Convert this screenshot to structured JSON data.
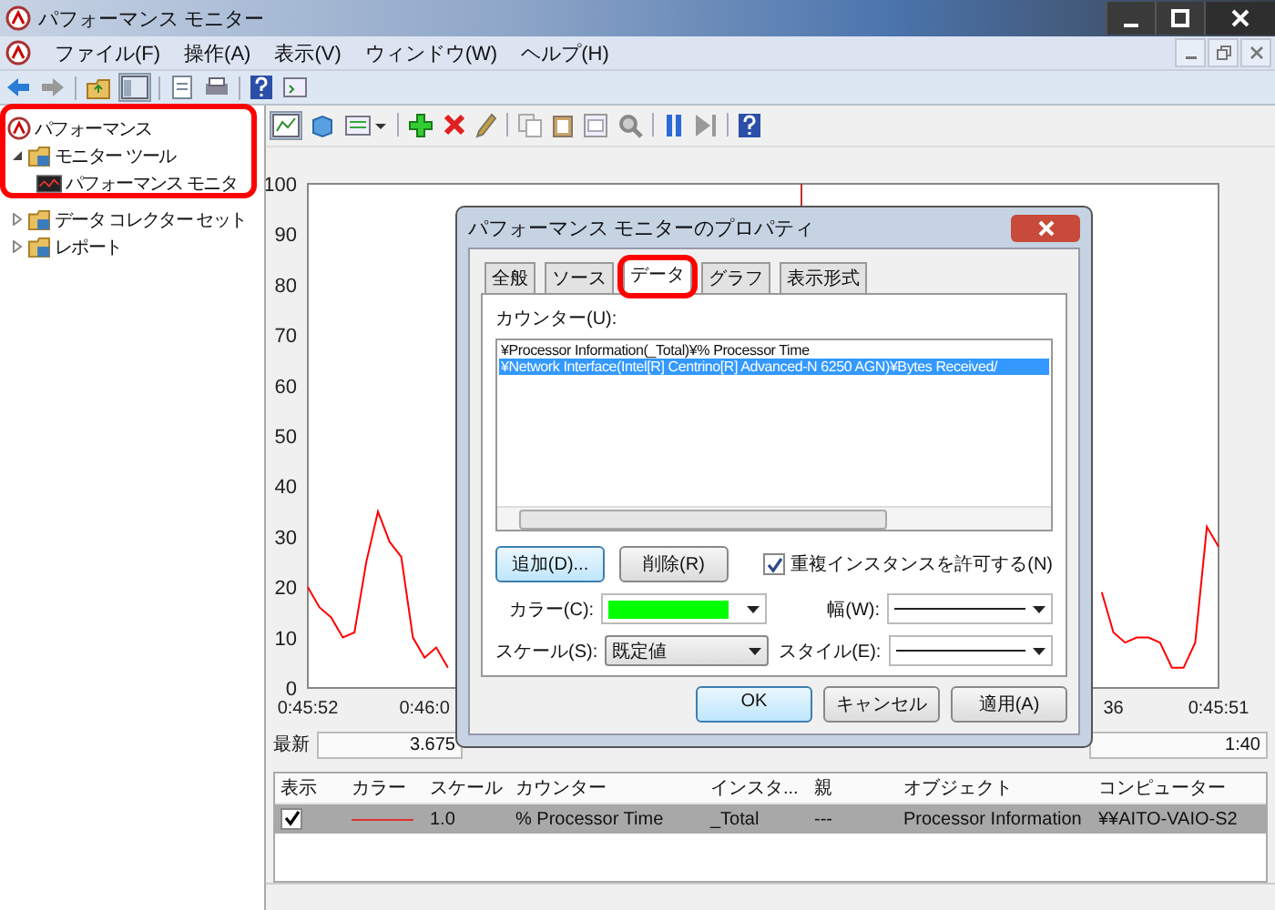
{
  "window": {
    "title": "パフォーマンス モニター"
  },
  "menu": [
    "ファイル(F)",
    "操作(A)",
    "表示(V)",
    "ウィンドウ(W)",
    "ヘルプ(H)"
  ],
  "tree": [
    {
      "label": "パフォーマンス",
      "children": [
        {
          "label": "モニター ツール",
          "expanded": true,
          "children": [
            {
              "label": "パフォーマンス モニタ"
            }
          ]
        },
        {
          "label": "データ コレクター セット",
          "expanded": false
        },
        {
          "label": "レポート",
          "expanded": false
        }
      ]
    }
  ],
  "graph": {
    "chart_data": {
      "type": "line",
      "ylim": [
        0,
        100
      ],
      "yticks": [
        0,
        10,
        20,
        30,
        40,
        50,
        60,
        70,
        80,
        90,
        100
      ],
      "categories": [
        "0:45:52",
        null,
        null,
        null,
        null,
        null,
        null,
        null,
        null,
        null,
        "0:46:0",
        null,
        null,
        null,
        null,
        null,
        null,
        null,
        null,
        null,
        null,
        null,
        null,
        null,
        null,
        null,
        null,
        null,
        null,
        null,
        null,
        null,
        null,
        null,
        null,
        null,
        null,
        null,
        null,
        null,
        null,
        null,
        null,
        null,
        null,
        null,
        null,
        null,
        null,
        null,
        null,
        null,
        null,
        null,
        null,
        null,
        null,
        null,
        null,
        null,
        null,
        null,
        null,
        null,
        null,
        null,
        null,
        null,
        null,
        "36",
        null,
        null,
        null,
        null,
        null,
        null,
        null,
        null,
        "0:45:51"
      ],
      "series": [
        {
          "color": "#ff0000",
          "values": [
            20,
            16,
            14,
            10,
            11,
            25,
            35,
            29,
            26,
            10,
            6,
            8,
            4,
            null,
            null,
            null,
            null,
            null,
            null,
            null,
            null,
            null,
            null,
            null,
            null,
            null,
            null,
            null,
            null,
            null,
            null,
            null,
            null,
            null,
            null,
            null,
            null,
            null,
            null,
            null,
            null,
            null,
            null,
            null,
            null,
            null,
            null,
            null,
            null,
            null,
            null,
            null,
            null,
            null,
            null,
            null,
            null,
            null,
            null,
            null,
            null,
            null,
            null,
            null,
            null,
            null,
            null,
            null,
            19,
            11,
            9,
            10,
            10,
            9,
            4,
            4,
            9,
            32,
            28
          ]
        }
      ]
    }
  },
  "stats": [
    {
      "label": "最新",
      "value": "3.675"
    },
    {
      "value": "1:40"
    }
  ],
  "legend": {
    "columns": [
      "表示",
      "カラー",
      "スケール",
      "カウンター",
      "インスタ...",
      "親",
      "オブジェクト",
      "コンピューター"
    ],
    "rows": [
      {
        "selected": true,
        "shown": true,
        "color": "#e03030",
        "scale": "1.0",
        "counter": "% Processor Time",
        "instance": "_Total",
        "parent": "---",
        "object": "Processor Information",
        "computer": "¥¥AITO-VAIO-S2"
      }
    ]
  },
  "dialog": {
    "title": "パフォーマンス モニターのプロパティ",
    "tabs": [
      {
        "label": "全般",
        "selected": false
      },
      {
        "label": "ソース",
        "selected": false
      },
      {
        "label": "データ",
        "selected": true
      },
      {
        "label": "グラフ",
        "selected": false
      },
      {
        "label": "表示形式",
        "selected": false
      }
    ],
    "counters_label": "カウンター(U):",
    "counters": [
      {
        "text": "¥Processor Information(_Total)¥% Processor Time",
        "selected": false
      },
      {
        "text": "¥Network Interface(Intel[R] Centrino[R] Advanced-N 6250 AGN)¥Bytes Received/",
        "selected": true
      }
    ],
    "add_button": "追加(D)...",
    "remove_button": "削除(R)",
    "allow_duplicates": {
      "label": "重複インスタンスを許可する(N)",
      "checked": true
    },
    "color": {
      "label": "カラー(C):",
      "color": "#00ff00"
    },
    "width": {
      "label": "幅(W):"
    },
    "scale": {
      "label": "スケール(S):",
      "value": "既定値"
    },
    "style": {
      "label": "スタイル(E):"
    },
    "buttons": [
      "OK",
      "キャンセル",
      "適用(A)"
    ]
  }
}
